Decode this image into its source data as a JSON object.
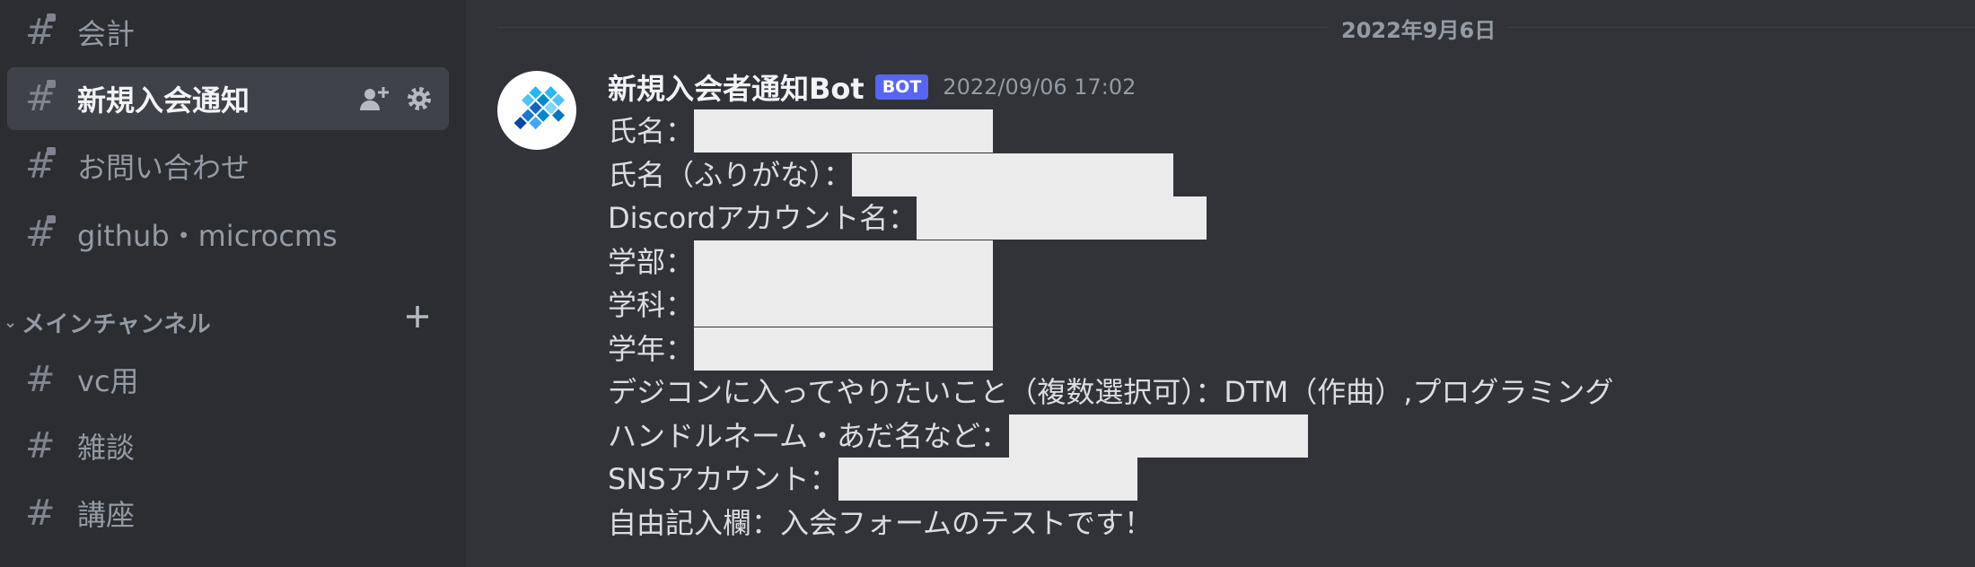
{
  "sidebar": {
    "channels_top": [
      {
        "name": "会計",
        "locked": true
      },
      {
        "name": "新規入会通知",
        "locked": true,
        "active": true
      },
      {
        "name": "お問い合わせ",
        "locked": true
      },
      {
        "name": "github・microcms",
        "locked": true
      }
    ],
    "category": {
      "label": "メインチャンネル"
    },
    "channels_main": [
      {
        "name": "vc用"
      },
      {
        "name": "雑談"
      },
      {
        "name": "講座"
      }
    ]
  },
  "chat": {
    "date_divider": "2022年9月6日",
    "message": {
      "author": "新規入会者通知Bot",
      "badge": "BOT",
      "timestamp": "2022/09/06 17:02",
      "lines": [
        {
          "label": "氏名：",
          "value": ""
        },
        {
          "label": "氏名（ふりがな）：",
          "value": ""
        },
        {
          "label": "Discordアカウント名：",
          "value": ""
        },
        {
          "label": "学部：",
          "value": ""
        },
        {
          "label": "学科：",
          "value": ""
        },
        {
          "label": "学年：",
          "value": ""
        },
        {
          "label": "デジコンに入ってやりたいこと（複数選択可）：",
          "value": "DTM（作曲）,プログラミング"
        },
        {
          "label": "ハンドルネーム・あだ名など：",
          "value": ""
        },
        {
          "label": "SNSアカウント：",
          "value": ""
        },
        {
          "label": "自由記入欄：",
          "value": "入会フォームのテストです！"
        }
      ]
    }
  },
  "colors": {
    "sidebar_bg": "#2b2d31",
    "chat_bg": "#313338",
    "active_channel_bg": "#404249",
    "bot_badge": "#5865f2",
    "redaction": "#ebebeb"
  }
}
